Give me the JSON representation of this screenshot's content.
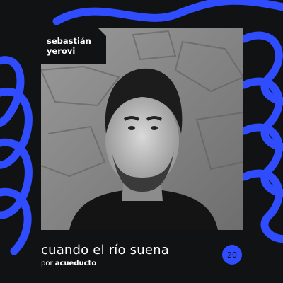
{
  "name_tag": {
    "line1": "sebastián",
    "line2": "yerovi"
  },
  "title": "cuando el río suena",
  "byline": {
    "prefix": "por",
    "brand": "acueducto"
  },
  "episode_number": "20",
  "colors": {
    "background": "#111214",
    "accent": "#2f4cff",
    "text": "#ffffff"
  },
  "image": {
    "subject": "black-and-white portrait photo of a man in front of a stone wall"
  }
}
